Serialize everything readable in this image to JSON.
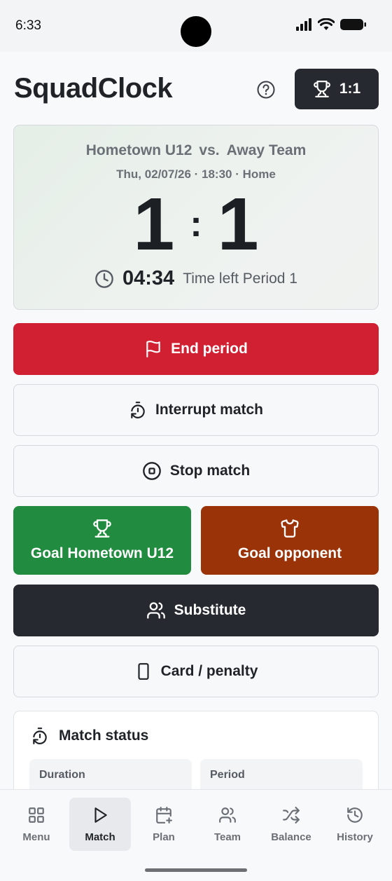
{
  "status_bar": {
    "time": "6:33"
  },
  "header": {
    "app_title": "SquadClock",
    "score_pill": "1:1"
  },
  "match": {
    "home_team": "Hometown U12",
    "vs": "vs.",
    "away_team": "Away Team",
    "meta": "Thu, 02/07/26 · 18:30 · Home",
    "home_score": "1",
    "separator": ":",
    "away_score": "1",
    "time_left": "04:34",
    "time_label": "Time left Period 1"
  },
  "actions": {
    "end_period": "End period",
    "interrupt": "Interrupt match",
    "stop": "Stop match",
    "goal_home": "Goal Hometown U12",
    "goal_opponent": "Goal opponent",
    "substitute": "Substitute",
    "card": "Card / penalty"
  },
  "match_status": {
    "title": "Match status",
    "duration_label": "Duration",
    "period_label": "Period"
  },
  "nav": {
    "items": [
      {
        "label": "Menu",
        "icon": "grid-icon"
      },
      {
        "label": "Match",
        "icon": "play-icon",
        "active": true
      },
      {
        "label": "Plan",
        "icon": "calendar-plus-icon"
      },
      {
        "label": "Team",
        "icon": "users-icon"
      },
      {
        "label": "Balance",
        "icon": "shuffle-icon"
      },
      {
        "label": "History",
        "icon": "history-icon"
      }
    ]
  },
  "colors": {
    "end_period": "#d02032",
    "goal_home": "#218b3f",
    "goal_opponent": "#9a3308",
    "dark": "#262a30"
  }
}
